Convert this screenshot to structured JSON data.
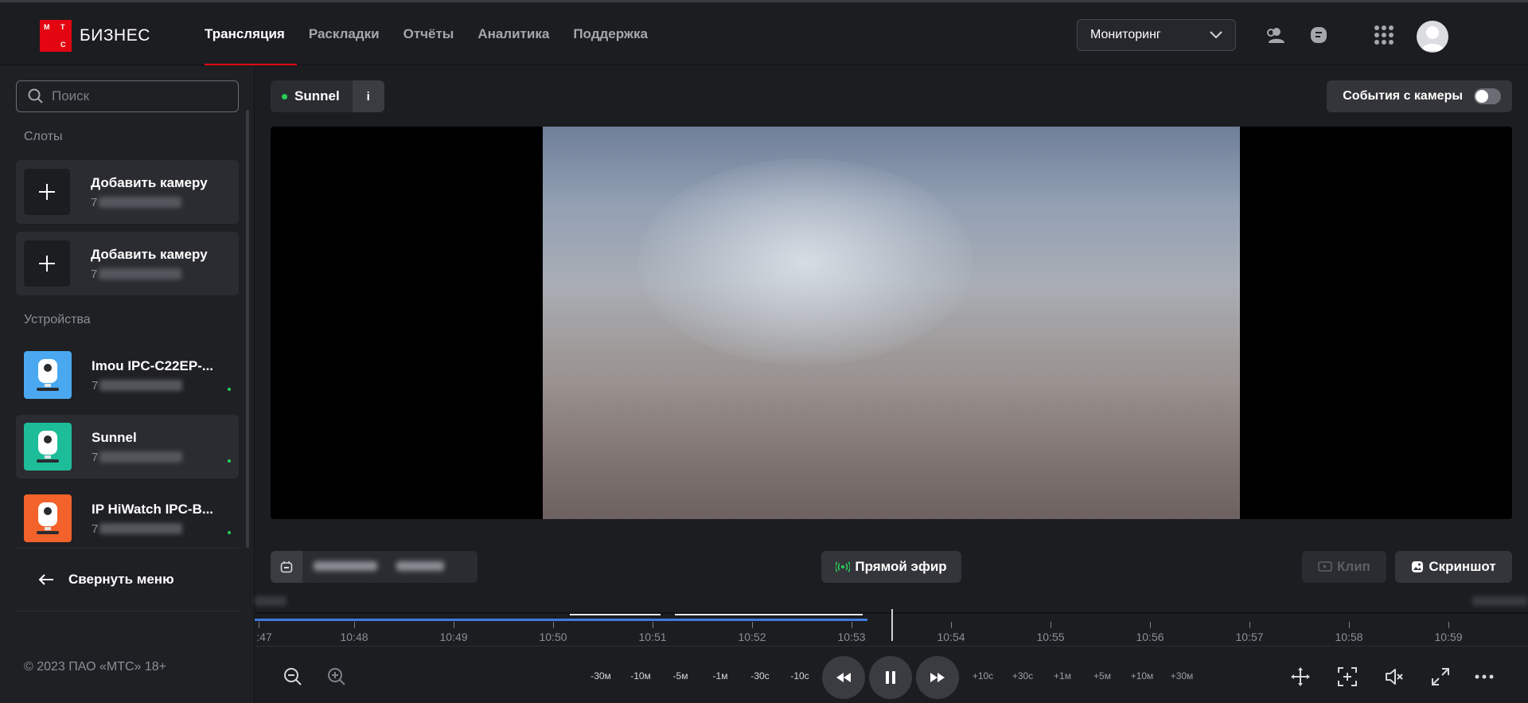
{
  "brand": {
    "logo_letters": [
      "М",
      "Т",
      "С"
    ],
    "name": "БИЗНЕС",
    "color": "#e30611"
  },
  "nav": {
    "items": [
      "Трансляция",
      "Раскладки",
      "Отчёты",
      "Аналитика",
      "Поддержка"
    ],
    "active": "Трансляция"
  },
  "header": {
    "mode_select": "Мониторинг",
    "icons": [
      "users-icon",
      "chat-icon",
      "apps-grid-icon",
      "avatar"
    ]
  },
  "sidebar": {
    "search_placeholder": "Поиск",
    "slots_title": "Слоты",
    "slots": [
      {
        "title": "Добавить камеру",
        "id_prefix": "7"
      },
      {
        "title": "Добавить камеру",
        "id_prefix": "7"
      }
    ],
    "devices_title": "Устройства",
    "devices": [
      {
        "title": "Imou IPC-C22EP-...",
        "id_prefix": "7",
        "thumb_color": "#4aa8f0",
        "status": "online"
      },
      {
        "title": "Sunnel",
        "id_prefix": "7",
        "thumb_color": "#1ebd9a",
        "status": "online",
        "active": true
      },
      {
        "title": "IP HiWatch IPC-B...",
        "id_prefix": "7",
        "thumb_color": "#f2622a",
        "status": "online"
      }
    ],
    "collapse_label": "Свернуть меню",
    "copyright": "© 2023 ПАО «МТС» 18+"
  },
  "player": {
    "camera_name": "Sunnel",
    "info_label": "i",
    "events_label": "События с камеры",
    "events_enabled": false,
    "live_label": "Прямой эфир",
    "clip_label": "Клип",
    "screenshot_label": "Скриншот",
    "timeline_labels": [
      ":47",
      "10:48",
      "10:49",
      "10:50",
      "10:51",
      "10:52",
      "10:53",
      "10:54",
      "10:55",
      "10:56",
      "10:57",
      "10:58",
      "10:59"
    ],
    "seek_back": [
      "-30м",
      "-10м",
      "-5м",
      "-1м",
      "-30с",
      "-10с"
    ],
    "seek_forward": [
      "+10с",
      "+30с",
      "+1м",
      "+5м",
      "+10м",
      "+30м"
    ]
  }
}
